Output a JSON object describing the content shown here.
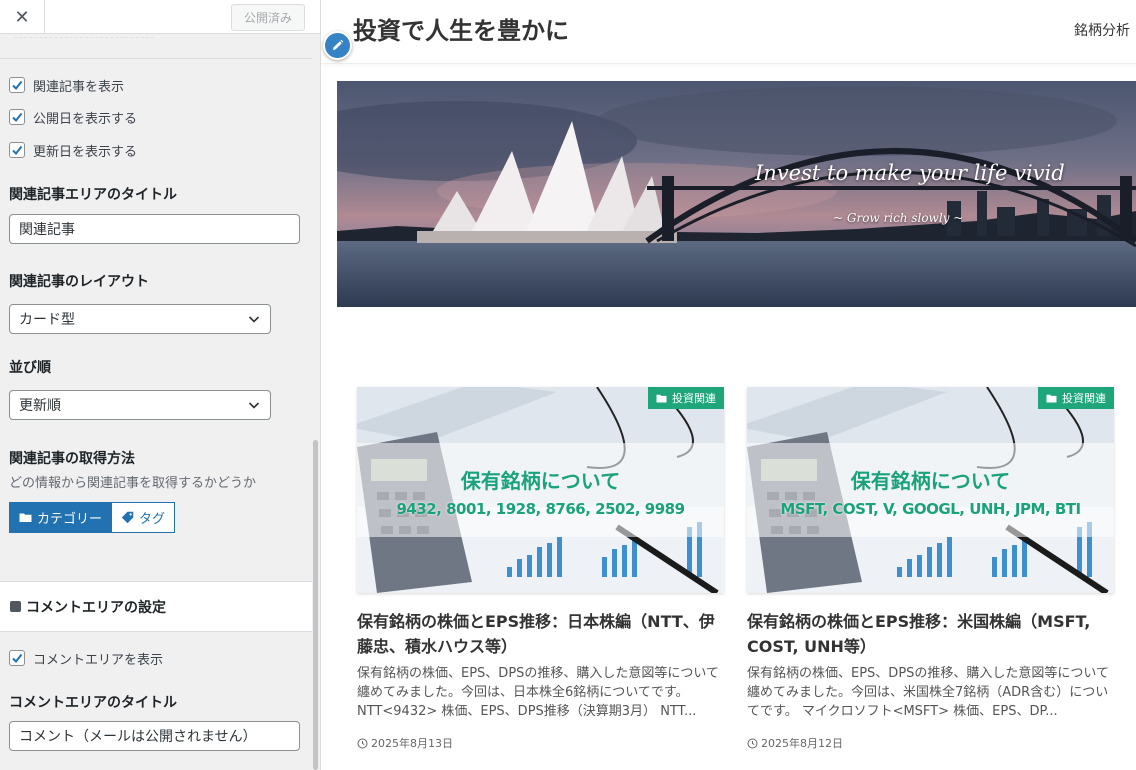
{
  "customizer": {
    "close_label": "✕",
    "publish_label": "公開済み",
    "related_options": {
      "show_related": {
        "label": "関連記事を表示",
        "checked": true
      },
      "show_published_date": {
        "label": "公開日を表示する",
        "checked": true
      },
      "show_updated_date": {
        "label": "更新日を表示する",
        "checked": true
      }
    },
    "related_title": {
      "label": "関連記事エリアのタイトル",
      "value": "関連記事"
    },
    "related_layout": {
      "label": "関連記事のレイアウト",
      "value": "カード型"
    },
    "sort_order": {
      "label": "並び順",
      "value": "更新順"
    },
    "fetch_method": {
      "label": "関連記事の取得方法",
      "description": "どの情報から関連記事を取得するかどうか",
      "options": [
        "カテゴリー",
        "タグ"
      ],
      "selected": "カテゴリー"
    },
    "comment_section": {
      "heading": "コメントエリアの設定",
      "show_comment": {
        "label": "コメントエリアを表示",
        "checked": true
      },
      "title": {
        "label": "コメントエリアのタイトル",
        "value": "コメント（メールは公開されません）"
      }
    }
  },
  "preview": {
    "site_title": "投資で人生を豊かに",
    "nav_item": "銘柄分析",
    "hero": {
      "title": "Invest to make your life vivid",
      "subtitle": "~ Grow rich slowly ~"
    },
    "posts": [
      {
        "category": "投資関連",
        "thumb_title": "保有銘柄について",
        "thumb_codes": "9432, 8001, 1928, 8766, 2502, 9989",
        "title": "保有銘柄の株価とEPS推移：日本株編（NTT、伊藤忠、積水ハウス等）",
        "excerpt": "保有銘柄の株価、EPS、DPSの推移、購入した意図等について纏めてみました。今回は、日本株全6銘柄についてです。NTT<9432> 株価、EPS、DPS推移（決算期3月） NTT...",
        "date": "2025年8月13日"
      },
      {
        "category": "投資関連",
        "thumb_title": "保有銘柄について",
        "thumb_codes": "MSFT, COST, V, GOOGL, UNH, JPM, BTI",
        "title": "保有銘柄の株価とEPS推移：米国株編（MSFT, COST, UNH等）",
        "excerpt": "保有銘柄の株価、EPS、DPSの推移、購入した意図等について纏めてみました。今回は、米国株全7銘柄（ADR含む）についてです。 マイクロソフト<MSFT> 株価、EPS、DP...",
        "date": "2025年8月12日"
      }
    ]
  },
  "colors": {
    "accent": "#2271b1",
    "category_badge": "#1fa57a",
    "thumb_text": "#1aa37a",
    "edit_shortcut": "#3582c4"
  }
}
